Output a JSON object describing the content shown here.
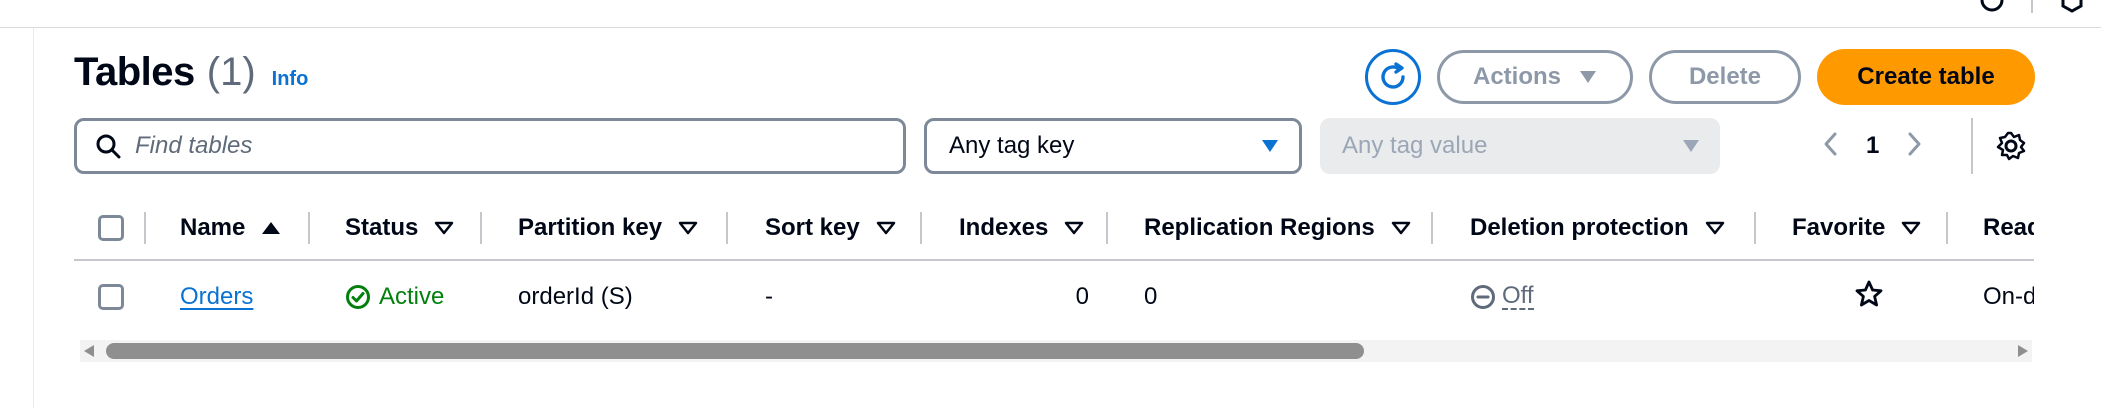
{
  "header": {
    "title": "Tables",
    "count": "(1)",
    "info_label": "Info"
  },
  "toolbar": {
    "actions_label": "Actions",
    "delete_label": "Delete",
    "create_label": "Create table"
  },
  "filters": {
    "search_placeholder": "Find tables",
    "tag_key_value": "Any tag key",
    "tag_value_placeholder": "Any tag value"
  },
  "pagination": {
    "current_page": "1"
  },
  "table": {
    "columns": [
      "Name",
      "Status",
      "Partition key",
      "Sort key",
      "Indexes",
      "Replication Regions",
      "Deletion protection",
      "Favorite",
      "Read capacity mode"
    ],
    "rows": [
      {
        "name": "Orders",
        "status": "Active",
        "partition_key": "orderId (S)",
        "sort_key": "-",
        "indexes": "0",
        "replication_regions": "0",
        "deletion_protection": "Off",
        "read_capacity_mode": "On-demand"
      }
    ]
  },
  "colors": {
    "primary": "#ff9900",
    "link": "#0972d3",
    "active": "#037f0c",
    "disabled": "#8d99a8"
  }
}
